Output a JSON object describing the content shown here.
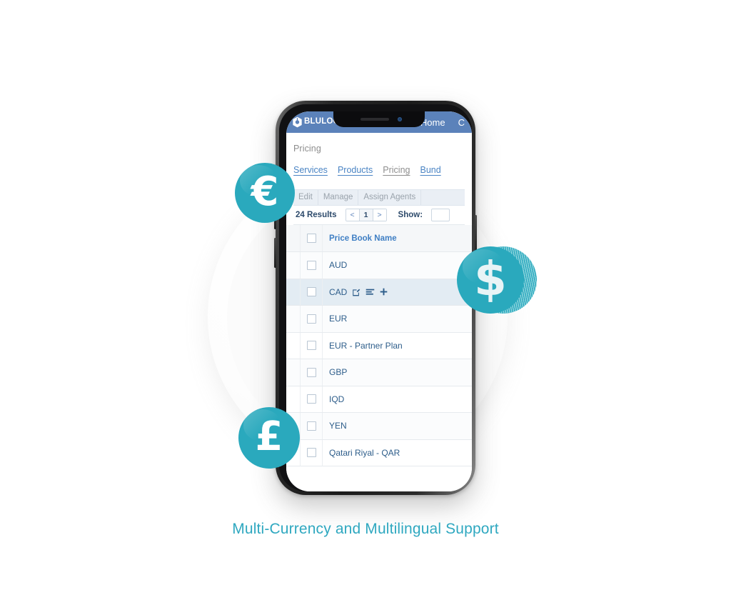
{
  "caption": "Multi-Currency and Multilingual Support",
  "theme": {
    "accent_teal": "#2aa9bd",
    "caption_teal": "#2fa8c0",
    "app_header_blue": "#5b82ba",
    "link_blue": "#3f7fc4",
    "text_dark_blue": "#2d5d8a"
  },
  "phone": {
    "device": "smartphone-mockup",
    "notch": {
      "speaker": "earpiece-speaker",
      "camera": "front-camera"
    },
    "buttons": [
      "silent-switch",
      "volume-up",
      "volume-down",
      "power"
    ]
  },
  "app": {
    "topbar": {
      "logo_text": "BLULOGIX",
      "nav": [
        {
          "label": "Home"
        },
        {
          "label": "C"
        }
      ]
    },
    "page_title": "Pricing",
    "tabs": [
      {
        "label": "Services",
        "active": false
      },
      {
        "label": "Products",
        "active": false
      },
      {
        "label": "Pricing",
        "active": true
      },
      {
        "label": "Bund",
        "active": false
      }
    ],
    "toolbar": [
      {
        "label": "Edit"
      },
      {
        "label": "Manage"
      },
      {
        "label": "Assign Agents"
      }
    ],
    "resultbar": {
      "results": "24 Results",
      "pager": {
        "prev": "<",
        "current": "1",
        "next": ">"
      },
      "show_label": "Show:",
      "show_value": ""
    },
    "table": {
      "header": "Price Book Name",
      "rows": [
        {
          "name": "AUD",
          "selected": false,
          "actions": []
        },
        {
          "name": "CAD",
          "selected": true,
          "actions": [
            "edit-icon",
            "list-icon",
            "plus-icon"
          ]
        },
        {
          "name": "EUR",
          "selected": false,
          "actions": []
        },
        {
          "name": "EUR - Partner Plan",
          "selected": false,
          "actions": []
        },
        {
          "name": "GBP",
          "selected": false,
          "actions": []
        },
        {
          "name": "IQD",
          "selected": false,
          "actions": []
        },
        {
          "name": "YEN",
          "selected": false,
          "actions": []
        },
        {
          "name": "Qatari Riyal - QAR",
          "selected": false,
          "actions": []
        }
      ]
    }
  },
  "badges": [
    {
      "id": "euro",
      "glyph": "€",
      "name": "euro-currency-badge"
    },
    {
      "id": "dollar",
      "glyph": "$",
      "name": "dollar-currency-badge"
    },
    {
      "id": "pound",
      "glyph": "£",
      "name": "pound-currency-badge"
    }
  ]
}
